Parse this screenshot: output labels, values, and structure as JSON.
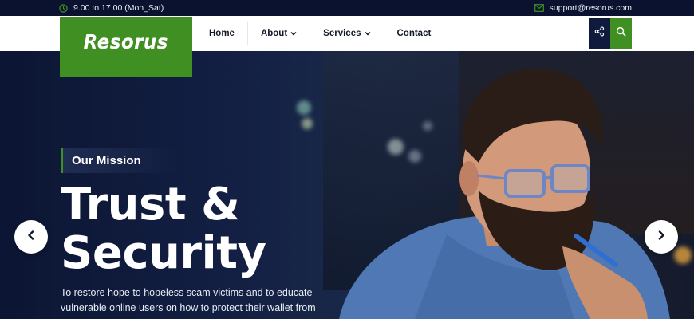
{
  "topbar": {
    "hours": "9.00 to 17.00 (Mon_Sat)",
    "email": "support@resorus.com"
  },
  "brand": {
    "logo_text": "Resorus",
    "accent_color": "#3f8f23",
    "navy_color": "#0f1a3c"
  },
  "nav": {
    "items": [
      {
        "label": "Home"
      },
      {
        "label": "About",
        "has_dropdown": true
      },
      {
        "label": "Services",
        "has_dropdown": true
      },
      {
        "label": "Contact"
      }
    ],
    "share_icon": "share-icon",
    "search_icon": "search-icon"
  },
  "hero": {
    "kicker": "Our Mission",
    "headline_line1": "Trust &",
    "headline_line2": "Security",
    "description": "To restore hope to hopeless scam victims and to educate vulnerable online users on how to protect their wallet from",
    "prev_icon": "chevron-left-icon",
    "next_icon": "chevron-right-icon"
  }
}
